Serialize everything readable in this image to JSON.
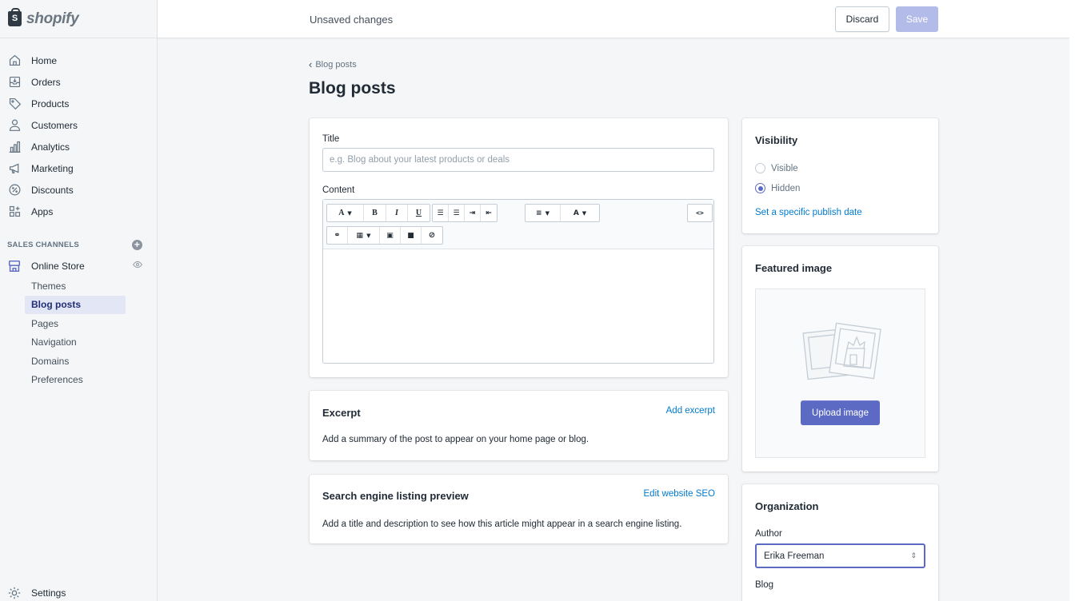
{
  "brand": {
    "name": "shopify",
    "mark": "S"
  },
  "topbar": {
    "title": "Unsaved changes",
    "discard_label": "Discard",
    "save_label": "Save"
  },
  "nav": {
    "items": [
      {
        "label": "Home",
        "icon": "home-icon"
      },
      {
        "label": "Orders",
        "icon": "orders-icon"
      },
      {
        "label": "Products",
        "icon": "tag-icon"
      },
      {
        "label": "Customers",
        "icon": "customer-icon"
      },
      {
        "label": "Analytics",
        "icon": "analytics-icon"
      },
      {
        "label": "Marketing",
        "icon": "megaphone-icon"
      },
      {
        "label": "Discounts",
        "icon": "discount-icon"
      },
      {
        "label": "Apps",
        "icon": "apps-icon"
      }
    ],
    "sales_channels_label": "SALES CHANNELS",
    "online_store_label": "Online Store",
    "sub_items": [
      "Themes",
      "Blog posts",
      "Pages",
      "Navigation",
      "Domains",
      "Preferences"
    ],
    "active_sub_item": "Blog posts",
    "settings_label": "Settings"
  },
  "page": {
    "breadcrumb": "Blog posts",
    "title": "Blog posts"
  },
  "post_card": {
    "title_label": "Title",
    "title_placeholder": "e.g. Blog about your latest products or deals",
    "title_value": "",
    "content_label": "Content"
  },
  "excerpt": {
    "title": "Excerpt",
    "link": "Add excerpt",
    "text": "Add a summary of the post to appear on your home page or blog."
  },
  "seo": {
    "title": "Search engine listing preview",
    "link": "Edit website SEO",
    "text": "Add a title and description to see how this article might appear in a search engine listing."
  },
  "visibility": {
    "title": "Visibility",
    "options": [
      "Visible",
      "Hidden"
    ],
    "selected": "Hidden",
    "link": "Set a specific publish date"
  },
  "featured_image": {
    "title": "Featured image",
    "upload_label": "Upload image"
  },
  "organization": {
    "title": "Organization",
    "author_label": "Author",
    "author_value": "Erika Freeman",
    "blog_label": "Blog"
  },
  "colors": {
    "accent": "#5c6ac4",
    "link": "#007ace",
    "save_disabled": "#b3bce9",
    "active_nav_bg": "#e3e6f4"
  }
}
